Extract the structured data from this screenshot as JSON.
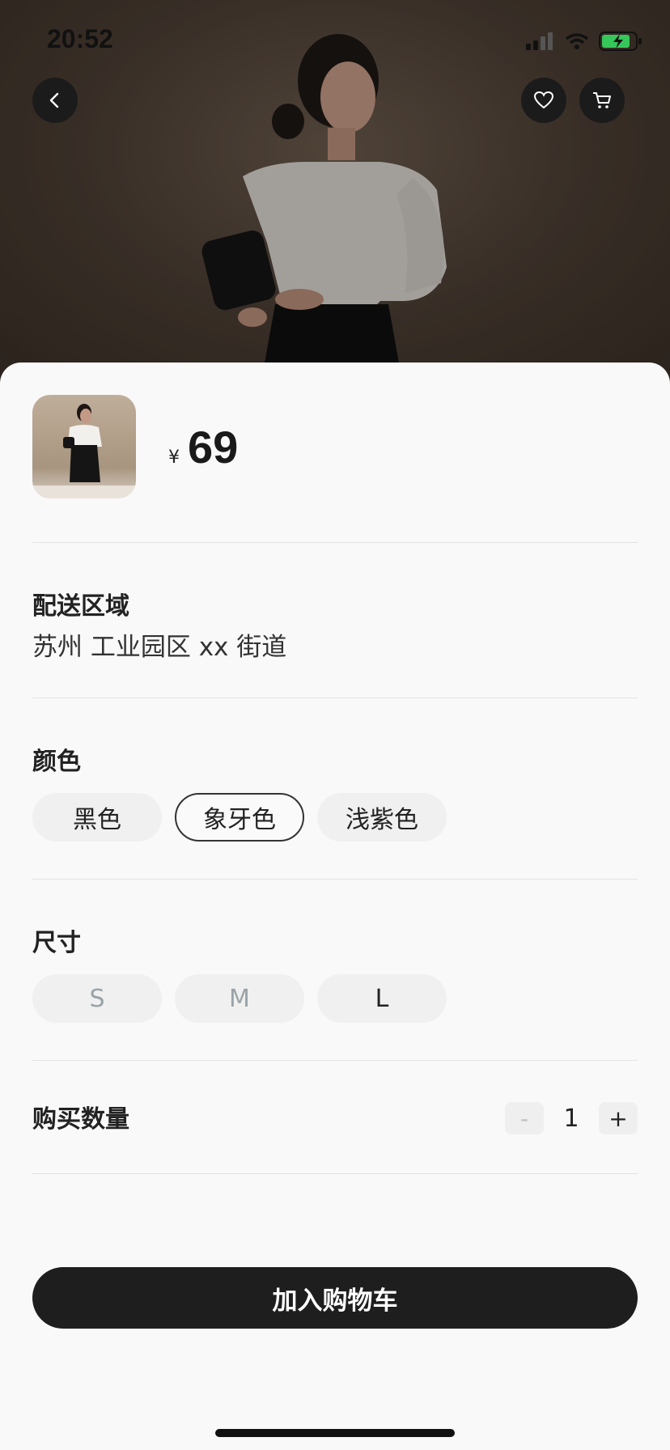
{
  "status_bar": {
    "time": "20:52"
  },
  "product": {
    "currency_symbol": "¥",
    "price": "69"
  },
  "delivery": {
    "title": "配送区域",
    "address": "苏州 工业园区 xx 街道"
  },
  "color": {
    "title": "颜色",
    "options": [
      "黑色",
      "象牙色",
      "浅紫色"
    ],
    "selected": "象牙色"
  },
  "size": {
    "title": "尺寸",
    "options": [
      "S",
      "M",
      "L"
    ],
    "disabled": [
      "S",
      "M"
    ]
  },
  "quantity": {
    "title": "购买数量",
    "minus_label": "-",
    "value": "1",
    "plus_label": "+"
  },
  "cta": {
    "label": "加入购物车"
  },
  "icons": {
    "back": "chevron-left-icon",
    "favorite": "heart-icon",
    "cart": "cart-icon"
  },
  "colors": {
    "primary": "#1e1e1e",
    "sheet_bg": "#f9f9f9",
    "chip_bg": "#f0f0f0",
    "disabled_text": "#9aa3a8"
  }
}
